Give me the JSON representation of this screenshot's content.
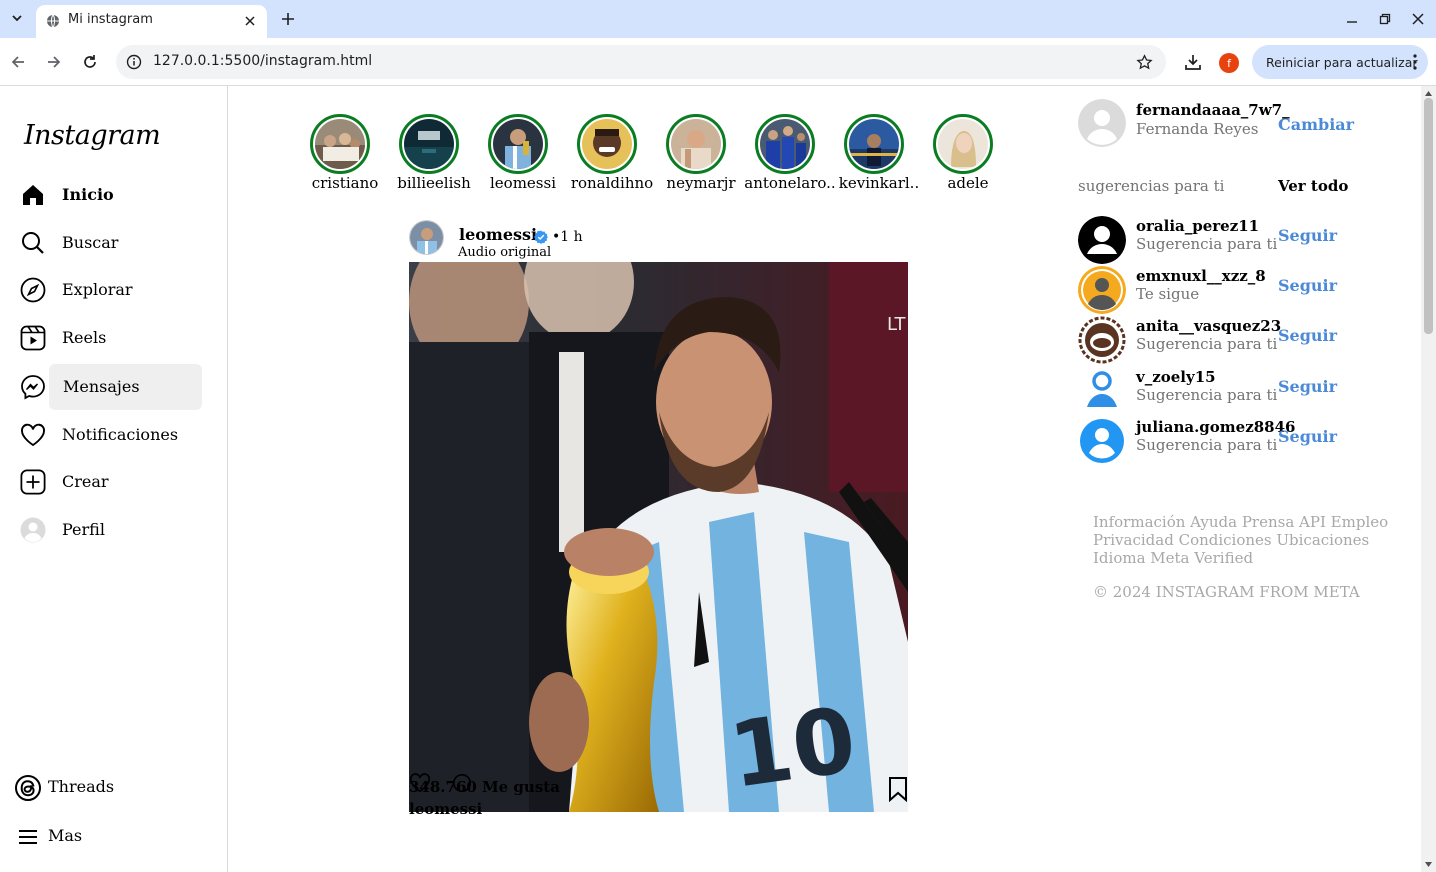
{
  "browser": {
    "tab_title": "Mi instagram",
    "url": "127.0.0.1:5500/instagram.html",
    "profile_initial": "f",
    "update_button": "Reiniciar para actualizar"
  },
  "sidebar": {
    "logo": "Instagram",
    "items": [
      {
        "label": "Inicio",
        "icon": "home-icon"
      },
      {
        "label": "Buscar",
        "icon": "search-icon"
      },
      {
        "label": "Explorar",
        "icon": "compass-icon"
      },
      {
        "label": "Reels",
        "icon": "reels-icon"
      },
      {
        "label": "Mensajes",
        "icon": "messenger-icon"
      },
      {
        "label": "Notificaciones",
        "icon": "heart-icon"
      },
      {
        "label": "Crear",
        "icon": "plus-square-icon"
      },
      {
        "label": "Perfil",
        "icon": "avatar-icon"
      }
    ],
    "bottom": [
      {
        "label": "Threads",
        "icon": "threads-icon"
      },
      {
        "label": "Mas",
        "icon": "menu-icon"
      }
    ]
  },
  "stories": [
    {
      "name": "cristiano"
    },
    {
      "name": "billieelish"
    },
    {
      "name": "leomessi"
    },
    {
      "name": "ronaldihno"
    },
    {
      "name": "neymarjr"
    },
    {
      "name": "antonelaro.."
    },
    {
      "name": "kevinkarl.."
    },
    {
      "name": "adele"
    }
  ],
  "post": {
    "username": "leomessi",
    "time": "•1 h",
    "audio": "Audio original",
    "likes": "348.760 Me gusta",
    "caption_user": "leomessi"
  },
  "right": {
    "me": {
      "username": "fernandaaaa_7w7_",
      "name": "Fernanda Reyes",
      "switch": "Cambiar"
    },
    "suggestions_title": "sugerencias para ti",
    "see_all": "Ver todo",
    "suggestions": [
      {
        "username": "oralia_perez11",
        "subtitle": "Sugerencia para ti",
        "action": "Seguir"
      },
      {
        "username": "emxnuxl__xzz_8",
        "subtitle": "Te sigue",
        "action": "Seguir"
      },
      {
        "username": "anita__vasquez23",
        "subtitle": "Sugerencia para ti",
        "action": "Seguir"
      },
      {
        "username": "v_zoely15",
        "subtitle": "Sugerencia para ti",
        "action": "Seguir"
      },
      {
        "username": "juliana.gomez8846",
        "subtitle": "Sugerencia para ti",
        "action": "Seguir"
      }
    ],
    "footer_links": "Información Ayuda Prensa API Empleo Privacidad Condiciones Ubicaciones Idioma Meta Verified",
    "copyright": "© 2024 INSTAGRAM FROM META"
  },
  "colors": {
    "story_ring": "#0a7d23",
    "link_blue": "#4c8ad7",
    "tabbar": "#d3e3fd"
  }
}
